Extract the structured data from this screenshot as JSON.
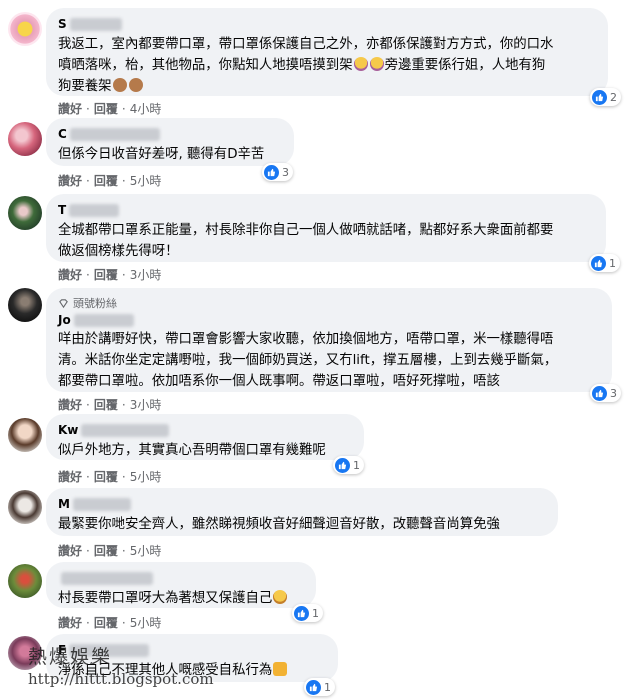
{
  "colors": {
    "like_blue": "#1877f2",
    "bubble_bg": "#f0f2f5",
    "meta_text": "#65676b"
  },
  "actions": {
    "like": "讚好",
    "reply": "回覆",
    "sep": "·"
  },
  "comments": [
    {
      "name": "S",
      "lines": [
        "我返工，室內都要帶口罩，帶口罩係保護自己之外，亦都係保護對方方式，你的口水",
        "噴晒落咪，枱，其他物品，你點知人地摸唔摸到架",
        "旁邊重要係行姐，人地有狗",
        "狗要養架"
      ],
      "time": "4小時",
      "reactions": "2"
    },
    {
      "name": "C",
      "lines": [
        "但係今日收音好差呀, 聽得有D辛苦"
      ],
      "time": "5小時",
      "reactions": "3"
    },
    {
      "name": "T",
      "lines": [
        "全城都帶口罩系正能量，村長除非你自己一個人做哂就話啫，點都好系大衆面前都要",
        "做返個榜樣先得呀！"
      ],
      "time": "3小時",
      "reactions": "1"
    },
    {
      "badge": "頭號粉絲",
      "name": "Jo",
      "lines": [
        "咩由於講嘢好快，帶口罩會影響大家收聽，依加換個地方，唔帶口罩，米一樣聽得唔",
        "清。米話你坐定定講嘢啦，我一個師奶買送，又冇lift，撑五層樓，上到去幾乎斷氣，",
        "都要帶口罩啦。依加唔系你一個人既事啊。帶返口罩啦，唔好死撑啦，唔該"
      ],
      "time": "3小時",
      "reactions": "3"
    },
    {
      "name": "Kw",
      "lines": [
        "似戶外地方，其實真心吾明帶個口罩有幾難呢"
      ],
      "time": "5小時",
      "reactions": "1"
    },
    {
      "name": "M",
      "lines": [
        "最緊要你哋安全齊人，雖然睇視頻收音好細聲迴音好散，改聽聲音尚算免強"
      ],
      "time": "5小時",
      "reactions": ""
    },
    {
      "name": "",
      "lines": [
        "村長要帶口罩呀大為著想又保護自己"
      ],
      "time": "5小時",
      "reactions": "1"
    },
    {
      "name": "F",
      "lines": [
        "淨係自己不理其他人嘅感受自私行為"
      ],
      "time": "",
      "reactions": "1"
    }
  ],
  "watermark": {
    "line1": "熱爆娛樂",
    "line2": "http://hittt.blogspot.com"
  }
}
